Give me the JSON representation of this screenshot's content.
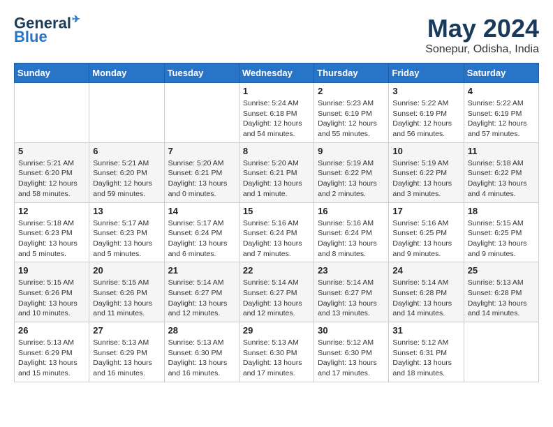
{
  "header": {
    "logo_line1": "General",
    "logo_line2": "Blue",
    "month": "May 2024",
    "location": "Sonepur, Odisha, India"
  },
  "weekdays": [
    "Sunday",
    "Monday",
    "Tuesday",
    "Wednesday",
    "Thursday",
    "Friday",
    "Saturday"
  ],
  "weeks": [
    [
      {
        "day": "",
        "info": ""
      },
      {
        "day": "",
        "info": ""
      },
      {
        "day": "",
        "info": ""
      },
      {
        "day": "1",
        "info": "Sunrise: 5:24 AM\nSunset: 6:18 PM\nDaylight: 12 hours\nand 54 minutes."
      },
      {
        "day": "2",
        "info": "Sunrise: 5:23 AM\nSunset: 6:19 PM\nDaylight: 12 hours\nand 55 minutes."
      },
      {
        "day": "3",
        "info": "Sunrise: 5:22 AM\nSunset: 6:19 PM\nDaylight: 12 hours\nand 56 minutes."
      },
      {
        "day": "4",
        "info": "Sunrise: 5:22 AM\nSunset: 6:19 PM\nDaylight: 12 hours\nand 57 minutes."
      }
    ],
    [
      {
        "day": "5",
        "info": "Sunrise: 5:21 AM\nSunset: 6:20 PM\nDaylight: 12 hours\nand 58 minutes."
      },
      {
        "day": "6",
        "info": "Sunrise: 5:21 AM\nSunset: 6:20 PM\nDaylight: 12 hours\nand 59 minutes."
      },
      {
        "day": "7",
        "info": "Sunrise: 5:20 AM\nSunset: 6:21 PM\nDaylight: 13 hours\nand 0 minutes."
      },
      {
        "day": "8",
        "info": "Sunrise: 5:20 AM\nSunset: 6:21 PM\nDaylight: 13 hours\nand 1 minute."
      },
      {
        "day": "9",
        "info": "Sunrise: 5:19 AM\nSunset: 6:22 PM\nDaylight: 13 hours\nand 2 minutes."
      },
      {
        "day": "10",
        "info": "Sunrise: 5:19 AM\nSunset: 6:22 PM\nDaylight: 13 hours\nand 3 minutes."
      },
      {
        "day": "11",
        "info": "Sunrise: 5:18 AM\nSunset: 6:22 PM\nDaylight: 13 hours\nand 4 minutes."
      }
    ],
    [
      {
        "day": "12",
        "info": "Sunrise: 5:18 AM\nSunset: 6:23 PM\nDaylight: 13 hours\nand 5 minutes."
      },
      {
        "day": "13",
        "info": "Sunrise: 5:17 AM\nSunset: 6:23 PM\nDaylight: 13 hours\nand 5 minutes."
      },
      {
        "day": "14",
        "info": "Sunrise: 5:17 AM\nSunset: 6:24 PM\nDaylight: 13 hours\nand 6 minutes."
      },
      {
        "day": "15",
        "info": "Sunrise: 5:16 AM\nSunset: 6:24 PM\nDaylight: 13 hours\nand 7 minutes."
      },
      {
        "day": "16",
        "info": "Sunrise: 5:16 AM\nSunset: 6:24 PM\nDaylight: 13 hours\nand 8 minutes."
      },
      {
        "day": "17",
        "info": "Sunrise: 5:16 AM\nSunset: 6:25 PM\nDaylight: 13 hours\nand 9 minutes."
      },
      {
        "day": "18",
        "info": "Sunrise: 5:15 AM\nSunset: 6:25 PM\nDaylight: 13 hours\nand 9 minutes."
      }
    ],
    [
      {
        "day": "19",
        "info": "Sunrise: 5:15 AM\nSunset: 6:26 PM\nDaylight: 13 hours\nand 10 minutes."
      },
      {
        "day": "20",
        "info": "Sunrise: 5:15 AM\nSunset: 6:26 PM\nDaylight: 13 hours\nand 11 minutes."
      },
      {
        "day": "21",
        "info": "Sunrise: 5:14 AM\nSunset: 6:27 PM\nDaylight: 13 hours\nand 12 minutes."
      },
      {
        "day": "22",
        "info": "Sunrise: 5:14 AM\nSunset: 6:27 PM\nDaylight: 13 hours\nand 12 minutes."
      },
      {
        "day": "23",
        "info": "Sunrise: 5:14 AM\nSunset: 6:27 PM\nDaylight: 13 hours\nand 13 minutes."
      },
      {
        "day": "24",
        "info": "Sunrise: 5:14 AM\nSunset: 6:28 PM\nDaylight: 13 hours\nand 14 minutes."
      },
      {
        "day": "25",
        "info": "Sunrise: 5:13 AM\nSunset: 6:28 PM\nDaylight: 13 hours\nand 14 minutes."
      }
    ],
    [
      {
        "day": "26",
        "info": "Sunrise: 5:13 AM\nSunset: 6:29 PM\nDaylight: 13 hours\nand 15 minutes."
      },
      {
        "day": "27",
        "info": "Sunrise: 5:13 AM\nSunset: 6:29 PM\nDaylight: 13 hours\nand 16 minutes."
      },
      {
        "day": "28",
        "info": "Sunrise: 5:13 AM\nSunset: 6:30 PM\nDaylight: 13 hours\nand 16 minutes."
      },
      {
        "day": "29",
        "info": "Sunrise: 5:13 AM\nSunset: 6:30 PM\nDaylight: 13 hours\nand 17 minutes."
      },
      {
        "day": "30",
        "info": "Sunrise: 5:12 AM\nSunset: 6:30 PM\nDaylight: 13 hours\nand 17 minutes."
      },
      {
        "day": "31",
        "info": "Sunrise: 5:12 AM\nSunset: 6:31 PM\nDaylight: 13 hours\nand 18 minutes."
      },
      {
        "day": "",
        "info": ""
      }
    ]
  ]
}
